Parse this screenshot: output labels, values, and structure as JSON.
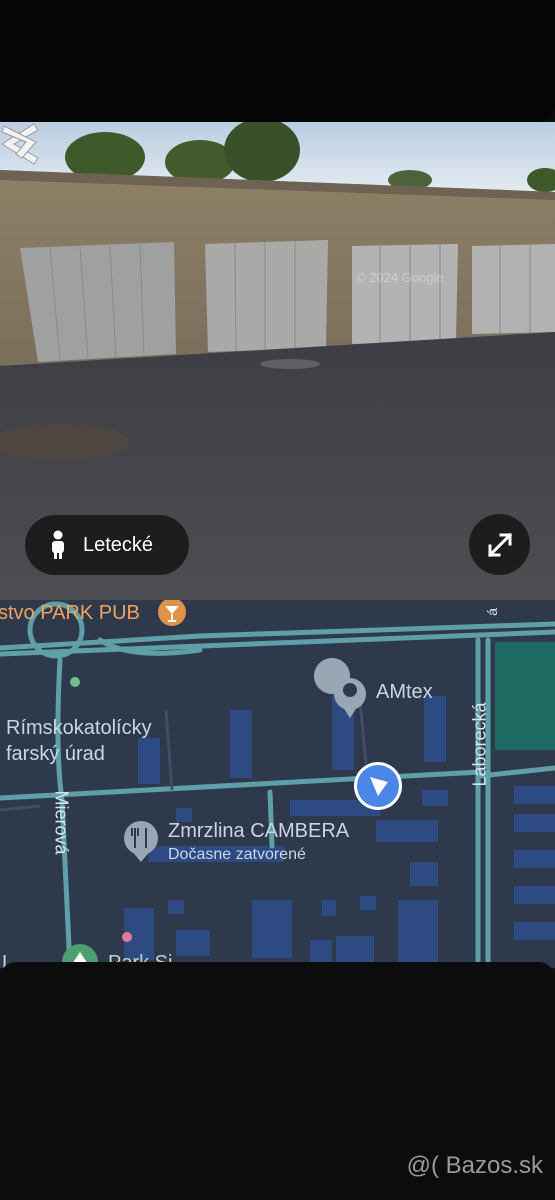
{
  "street_view": {
    "watermark": "© 2024 Google",
    "mode_button_label": "Letecké",
    "icons": {
      "mode": "person-icon",
      "expand": "expand-icon",
      "left": "chevron-left-icon",
      "right": "chevron-right-icon"
    }
  },
  "map": {
    "places": {
      "pub": "stvo PARK PUB",
      "amtex": "AMtex",
      "church_line1": "Rímskokatolícky",
      "church_line2": "farský úrad",
      "icecream": "Zmrzlina CAMBERA",
      "icecream_status": "Dočasne zatvorené",
      "park": "Park Si...",
      "park_left": "L..."
    },
    "streets": {
      "mierova": "Mierová",
      "laborecka": "Laborecká",
      "laborecka_top": "á"
    },
    "colors": {
      "background": "#2e3a4c",
      "road": "#5fa0a8",
      "building": "#2e4a82",
      "park_green": "#1e6a62",
      "location_dot": "#4a86e8"
    }
  },
  "footer": {
    "brand": "@( Bazos.sk"
  }
}
